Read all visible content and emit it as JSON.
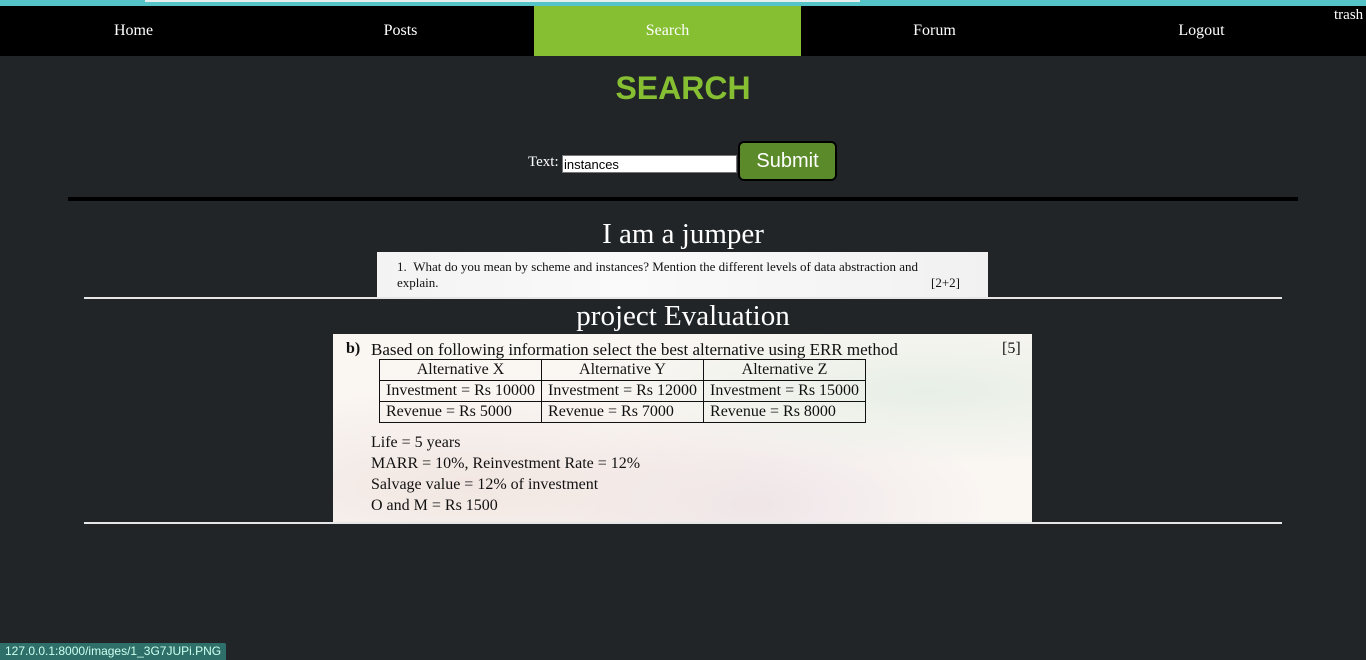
{
  "nav": {
    "items": [
      {
        "label": "Home"
      },
      {
        "label": "Posts"
      },
      {
        "label": "Search",
        "active": true
      },
      {
        "label": "Forum"
      },
      {
        "label": "Logout"
      }
    ],
    "active_color": "#86bf32",
    "corner_text": "trash"
  },
  "page": {
    "title": "SEARCH",
    "title_color": "#86bf32"
  },
  "search": {
    "label": "Text:",
    "value": "instances",
    "submit_label": "Submit"
  },
  "results": [
    {
      "title": "I am a jumper",
      "image": {
        "number": "1.",
        "question": "What do you mean by scheme and instances? Mention the different levels of data abstraction and explain.",
        "marks": "[2+2]"
      }
    },
    {
      "title": "project Evaluation",
      "image": {
        "label": "b)",
        "lead": "Based on following information select the best alternative using ERR method",
        "marks": "[5]",
        "table": {
          "headers": [
            "Alternative X",
            "Alternative Y",
            "Alternative Z"
          ],
          "rows": [
            [
              "Investment = Rs 10000",
              "Investment = Rs 12000",
              "Investment = Rs 15000"
            ],
            [
              "Revenue = Rs 5000",
              "Revenue = Rs 7000",
              "Revenue = Rs 8000"
            ]
          ]
        },
        "facts": [
          "Life = 5 years",
          "MARR = 10%, Reinvestment Rate = 12%",
          "Salvage value = 12% of investment",
          "O and M = Rs 1500"
        ]
      }
    }
  ],
  "status_bar": {
    "url": "127.0.0.1:8000/images/1_3G7JUPi.PNG"
  }
}
